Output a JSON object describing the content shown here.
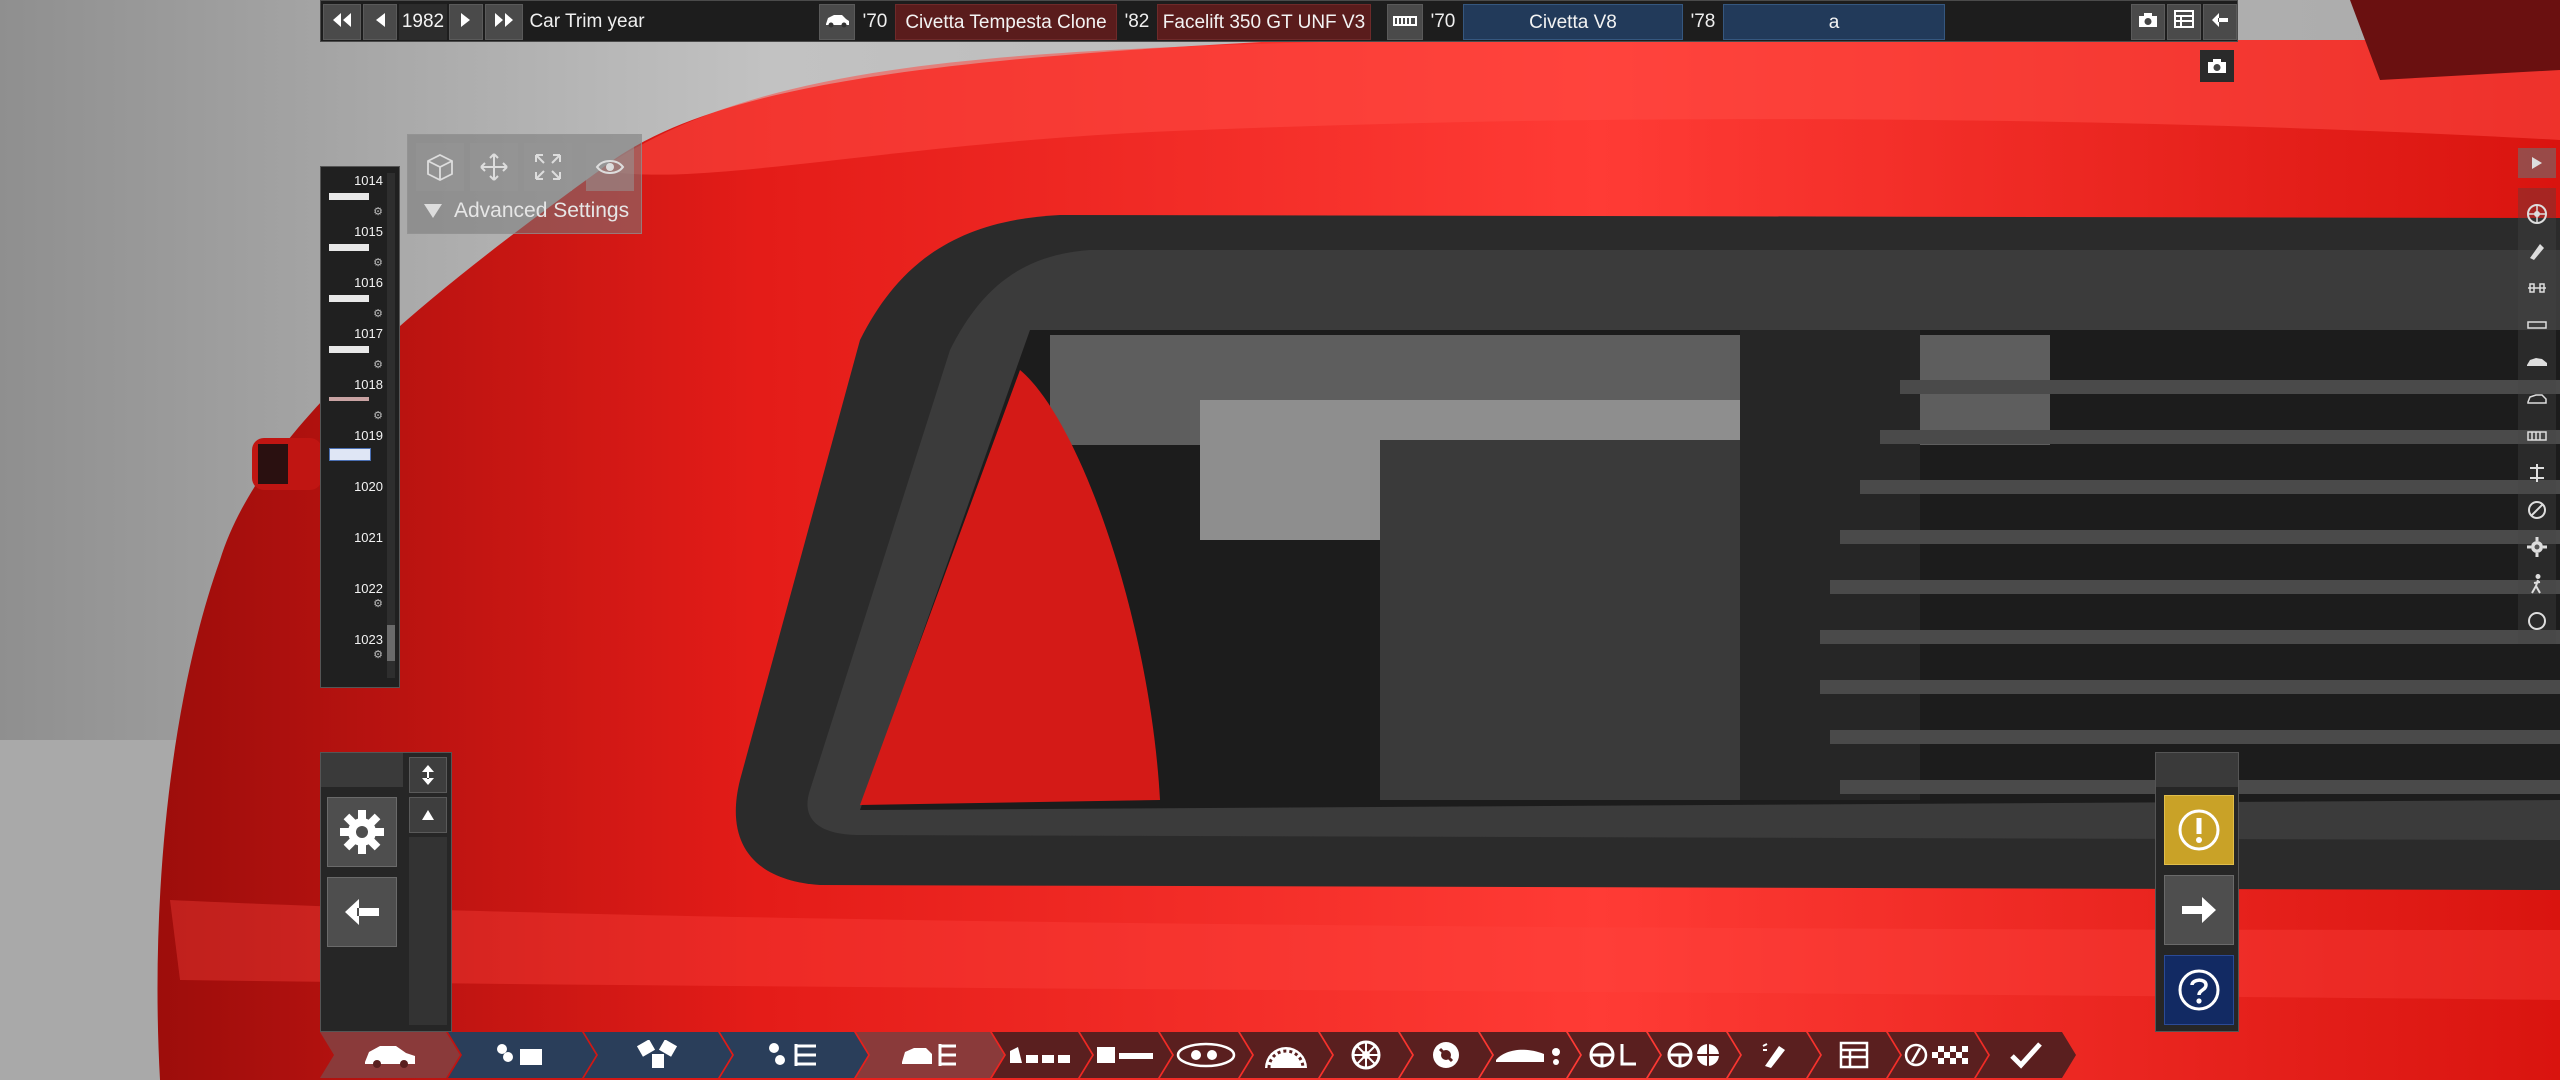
{
  "top_bar": {
    "nav_first_label": "first",
    "nav_prev_label": "previous",
    "year": "1982",
    "nav_next_label": "next",
    "nav_last_label": "last",
    "trim_year_label": "Car Trim year",
    "model_year": "'70",
    "model_name": "Civetta Tempesta Clone",
    "trim_year": "'82",
    "trim_name": "Facelift 350 GT UNF V3",
    "engine_family_year": "'70",
    "engine_family_name": "Civetta V8",
    "engine_variant_year": "'78",
    "engine_variant_name": "a"
  },
  "gizmo": {
    "advanced_label": "Advanced Settings"
  },
  "fixture_list": {
    "items": [
      {
        "id": "1014"
      },
      {
        "id": "1015"
      },
      {
        "id": "1016"
      },
      {
        "id": "1017"
      },
      {
        "id": "1018"
      },
      {
        "id": "1019"
      },
      {
        "id": "1020"
      },
      {
        "id": "1021"
      },
      {
        "id": "1022"
      },
      {
        "id": "1023"
      }
    ]
  },
  "icons": {
    "gear": "gear-icon",
    "back": "arrow-left-icon",
    "next": "arrow-right-icon",
    "warning": "exclamation-icon",
    "help": "question-icon",
    "screenshot": "camera-icon"
  },
  "colors": {
    "car_paint": "#e8201c",
    "warning_button": "#c9a227",
    "help_button": "#122a63",
    "bottom_tab_active": "#8a3a3a",
    "bottom_tab_blue": "#2a3e5a",
    "bottom_tab_red": "#5a1f1f"
  }
}
